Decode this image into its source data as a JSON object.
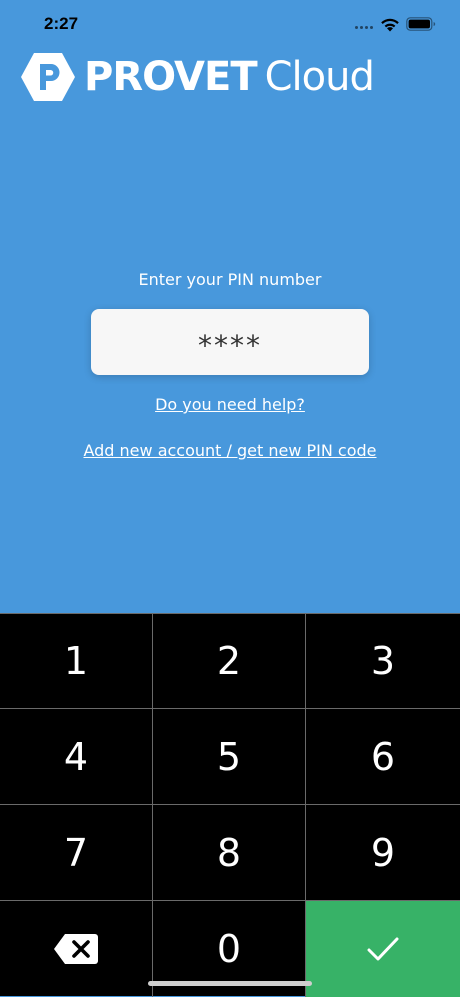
{
  "status_bar": {
    "time": "2:27",
    "icons": [
      "signal-icon",
      "wifi-icon",
      "battery-icon"
    ]
  },
  "logo": {
    "brand_bold": "PROVET",
    "brand_light": "Cloud"
  },
  "login": {
    "prompt": "Enter your PIN number",
    "pin_value": "****",
    "help_link": "Do you need help?",
    "add_account_link": "Add new account / get new PIN code"
  },
  "keypad": {
    "keys": [
      "1",
      "2",
      "3",
      "4",
      "5",
      "6",
      "7",
      "8",
      "9",
      "0"
    ],
    "backspace_icon": "backspace-icon",
    "confirm_icon": "check-icon"
  },
  "colors": {
    "background": "#4898dc",
    "keypad_background": "#000000",
    "confirm_key": "#37b267",
    "pin_field": "#f7f7f7"
  }
}
